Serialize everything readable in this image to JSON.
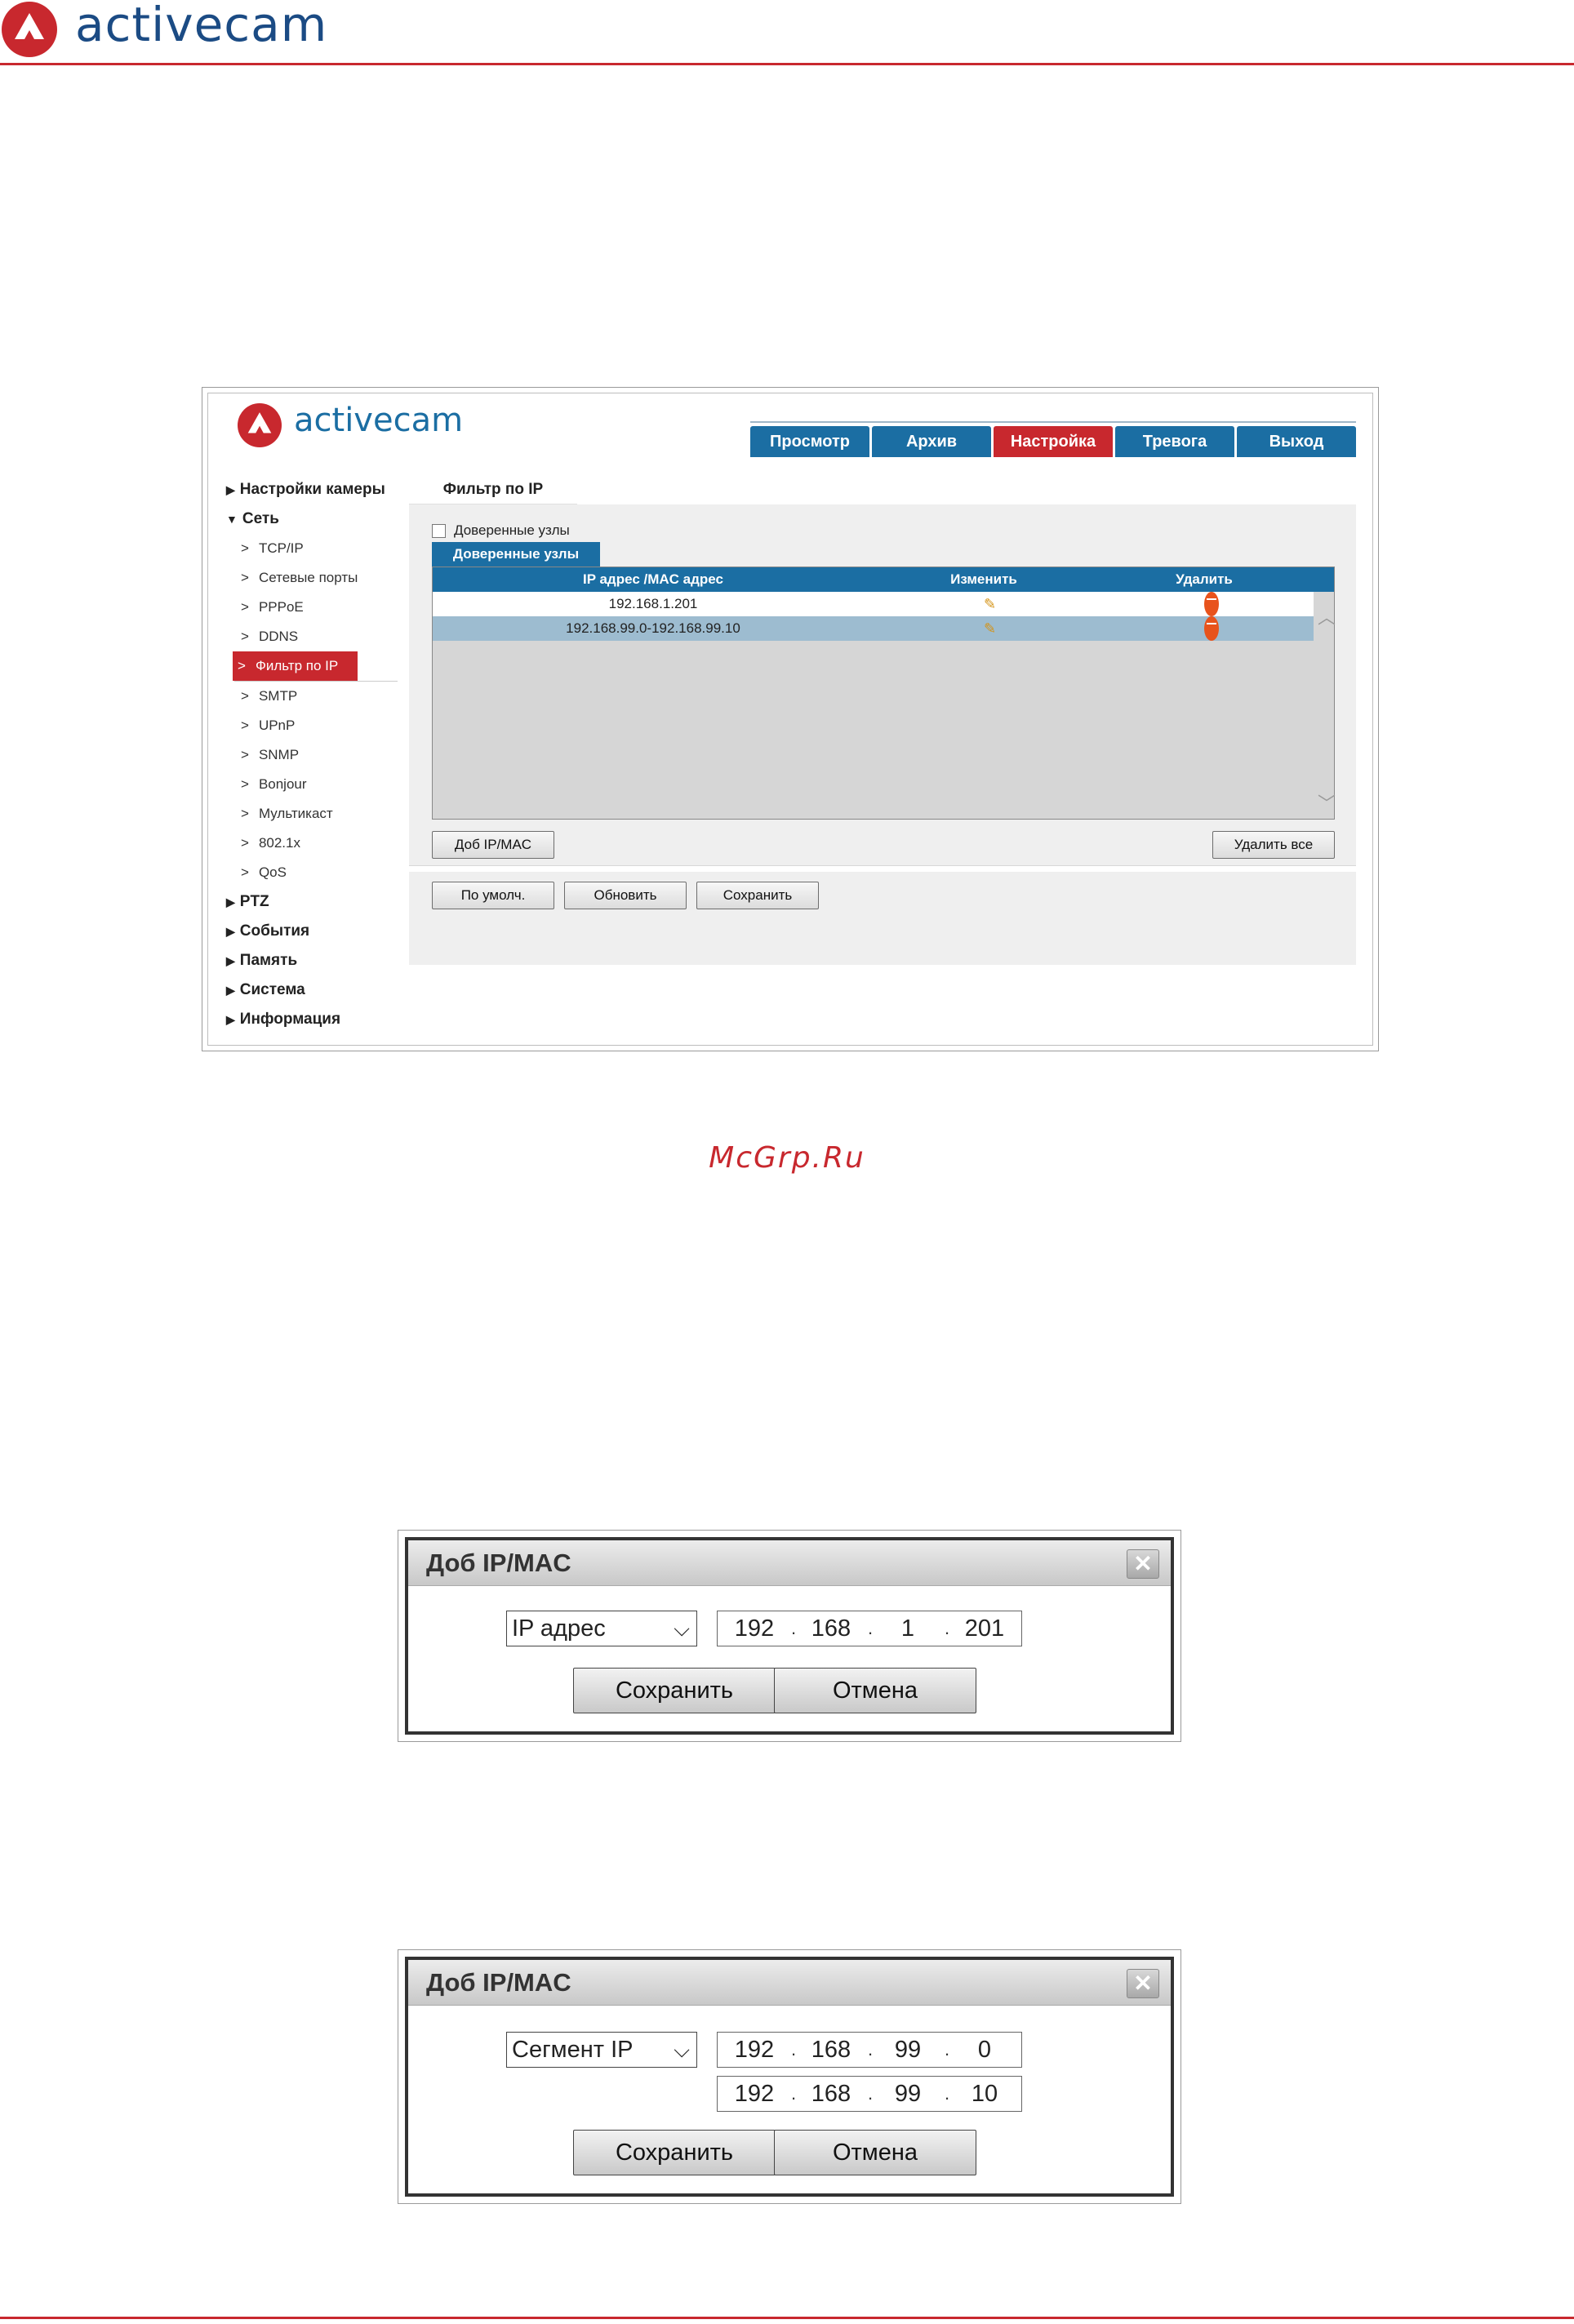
{
  "header": {
    "brand": "activecam"
  },
  "app": {
    "brand": "activecam",
    "tabs": [
      "Просмотр",
      "Архив",
      "Настройка",
      "Тревога",
      "Выход"
    ],
    "active_tab": "Настройка",
    "nav": {
      "camera_settings": "Настройки камеры",
      "network": "Сеть",
      "network_items": [
        "TCP/IP",
        "Сетевые порты",
        "PPPoE",
        "DDNS",
        "Фильтр по IP",
        "SMTP",
        "UPnP",
        "SNMP",
        "Bonjour",
        "Мультикаст",
        "802.1x",
        "QoS"
      ],
      "active_item": "Фильтр по IP",
      "sections": [
        "PTZ",
        "События",
        "Память",
        "Система",
        "Информация"
      ]
    },
    "content": {
      "tab": "Фильтр по IP",
      "checkbox_label": "Доверенные узлы",
      "subtab": "Доверенные узлы",
      "columns": [
        "IP адрес /MAC адрес",
        "Изменить",
        "Удалить"
      ],
      "rows": [
        "192.168.1.201",
        "192.168.99.0-192.168.99.10"
      ],
      "add_button": "Доб IP/MAC",
      "delete_all_button": "Удалить все",
      "default_button": "По умолч.",
      "refresh_button": "Обновить",
      "save_button": "Сохранить"
    }
  },
  "watermark": "McGrp.Ru",
  "dialog1": {
    "title": "Доб IP/MAC",
    "type": "IP адрес",
    "ip": [
      "192",
      "168",
      "1",
      "201"
    ],
    "save": "Сохранить",
    "cancel": "Отмена"
  },
  "dialog2": {
    "title": "Доб IP/MAC",
    "type": "Сегмент IP",
    "ip_start": [
      "192",
      "168",
      "99",
      "0"
    ],
    "ip_end": [
      "192",
      "168",
      "99",
      "10"
    ],
    "save": "Сохранить",
    "cancel": "Отмена"
  },
  "colors": {
    "brand_red": "#c8282e",
    "brand_blue": "#1b6ea3",
    "logo_text_blue": "#1b4b84",
    "selected_row": "#9dbcd0"
  }
}
